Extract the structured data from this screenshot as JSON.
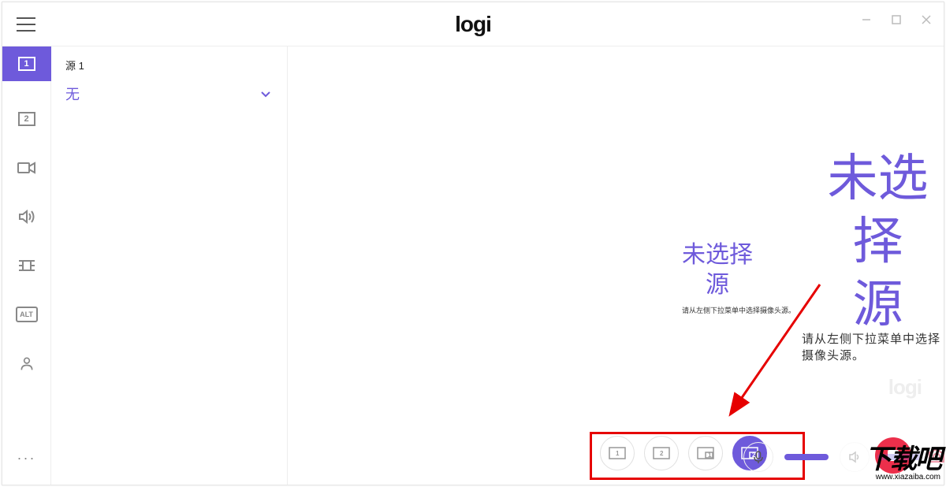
{
  "logo": "logi",
  "sidebar": {
    "source1": "1",
    "source2": "2",
    "alt": "ALT",
    "more": "···"
  },
  "source_panel": {
    "label": "源 1",
    "value": "无"
  },
  "messages": {
    "small_title_line1": "未选择",
    "small_title_line2": "源",
    "small_helper": "请从左侧下拉菜单中选择摄像头源。",
    "large_title_line1": "未选择",
    "large_title_line2": "源",
    "large_helper": "请从左侧下拉菜单中选择摄像头源。"
  },
  "layout_buttons": {
    "b1": "1",
    "b2": "2",
    "b3a": "1",
    "b4a": "2"
  },
  "ghost_logo": "logi",
  "watermark": {
    "big": "下载吧",
    "url": "www.xiazaiba.com"
  }
}
